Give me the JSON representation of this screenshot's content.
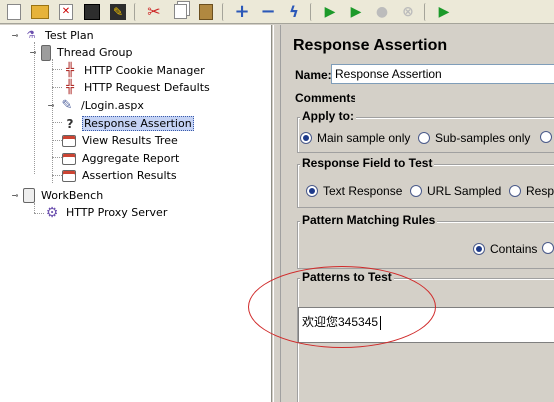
{
  "toolbar": {
    "buttons": [
      {
        "name": "new-button",
        "icon": "new-file-icon"
      },
      {
        "name": "open-button",
        "icon": "open-folder-icon"
      },
      {
        "name": "close-button",
        "icon": "close-file-icon"
      },
      {
        "name": "save-button",
        "icon": "save-icon"
      },
      {
        "name": "save-edit-button",
        "icon": "edit-icon"
      },
      {
        "name": "cut-button",
        "icon": "cut-icon"
      },
      {
        "name": "copy-button",
        "icon": "copy-icon"
      },
      {
        "name": "paste-button",
        "icon": "paste-icon"
      },
      {
        "name": "expand-button",
        "icon": "plus-icon"
      },
      {
        "name": "collapse-button",
        "icon": "minus-icon"
      },
      {
        "name": "toggle-button",
        "icon": "lightning-icon"
      },
      {
        "name": "start-button",
        "icon": "play-icon"
      },
      {
        "name": "start-no-pause-button",
        "icon": "play-noPause-icon"
      },
      {
        "name": "stop-button",
        "icon": "stop-icon"
      },
      {
        "name": "shutdown-button",
        "icon": "shutdown-icon"
      },
      {
        "name": "remote-start-button",
        "icon": "remote-start-icon"
      }
    ]
  },
  "tree": {
    "items": [
      {
        "label": "Test Plan",
        "icon": "flask-icon"
      },
      {
        "label": "Thread Group",
        "icon": "thread-group-icon"
      },
      {
        "label": "HTTP Cookie Manager",
        "icon": "config-icon"
      },
      {
        "label": "HTTP Request Defaults",
        "icon": "config-icon"
      },
      {
        "label": "/Login.aspx",
        "icon": "sampler-pipette-icon"
      },
      {
        "label": "Response Assertion",
        "icon": "assertion-icon"
      },
      {
        "label": "View Results Tree",
        "icon": "listener-icon"
      },
      {
        "label": "Aggregate Report",
        "icon": "listener-icon"
      },
      {
        "label": "Assertion Results",
        "icon": "listener-icon"
      },
      {
        "label": "WorkBench",
        "icon": "workbench-icon"
      },
      {
        "label": "HTTP Proxy Server",
        "icon": "proxy-gear-icon"
      }
    ]
  },
  "panel": {
    "title": "Response Assertion",
    "name_label": "Name:",
    "name_value": "Response Assertion",
    "comments_label": "Comments:",
    "apply_to": {
      "title": "Apply to:",
      "options": [
        "Main sample only",
        "Sub-samples only",
        ""
      ]
    },
    "response_field": {
      "title": "Response Field to Test",
      "options": [
        "Text Response",
        "URL Sampled",
        "Resp"
      ]
    },
    "pattern_rules": {
      "title": "Pattern Matching Rules",
      "options": [
        "Contains",
        ""
      ]
    },
    "patterns": {
      "title": "Patterns to Test",
      "value": "欢迎您345345"
    }
  },
  "colors": {
    "annotation_ellipse": "#d02a2a",
    "selection": "#c5d3f5",
    "panel_bg": "#d4d0c8"
  }
}
